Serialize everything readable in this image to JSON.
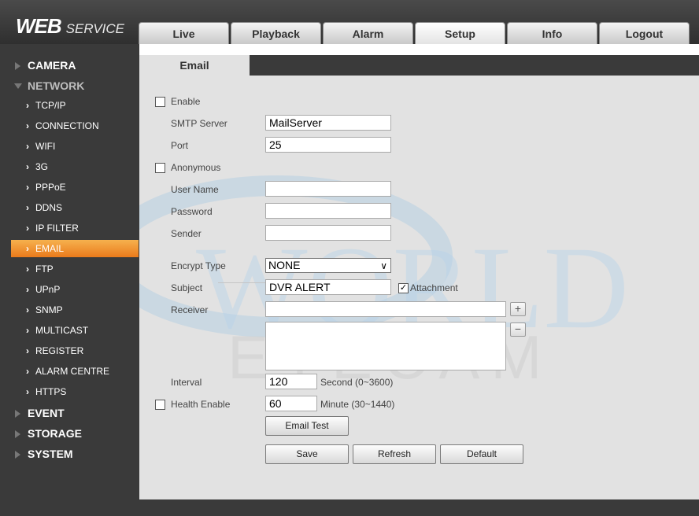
{
  "header": {
    "logo_main": "WEB",
    "logo_sub": "SERVICE"
  },
  "tabs": [
    {
      "label": "Live"
    },
    {
      "label": "Playback"
    },
    {
      "label": "Alarm"
    },
    {
      "label": "Setup",
      "active": true
    },
    {
      "label": "Info"
    },
    {
      "label": "Logout"
    }
  ],
  "sidebar": {
    "groups": [
      {
        "label": "CAMERA"
      },
      {
        "label": "NETWORK"
      },
      {
        "label": "EVENT"
      },
      {
        "label": "STORAGE"
      },
      {
        "label": "SYSTEM"
      }
    ],
    "network_items": [
      {
        "label": "TCP/IP"
      },
      {
        "label": "CONNECTION"
      },
      {
        "label": "WIFI"
      },
      {
        "label": "3G"
      },
      {
        "label": "PPPoE"
      },
      {
        "label": "DDNS"
      },
      {
        "label": "IP FILTER"
      },
      {
        "label": "EMAIL",
        "active": true
      },
      {
        "label": "FTP"
      },
      {
        "label": "UPnP"
      },
      {
        "label": "SNMP"
      },
      {
        "label": "MULTICAST"
      },
      {
        "label": "REGISTER"
      },
      {
        "label": "ALARM CENTRE"
      },
      {
        "label": "HTTPS"
      }
    ]
  },
  "email": {
    "tab_label": "Email",
    "enable_label": "Enable",
    "smtp_label": "SMTP Server",
    "smtp_value": "MailServer",
    "port_label": "Port",
    "port_value": "25",
    "anonymous_label": "Anonymous",
    "username_label": "User Name",
    "username_value": "",
    "password_label": "Password",
    "password_value": "",
    "sender_label": "Sender",
    "sender_value": "",
    "encrypt_label": "Encrypt Type",
    "encrypt_value": "NONE",
    "subject_label": "Subject",
    "subject_value": "DVR ALERT",
    "attachment_label": "Attachment",
    "attachment_checked": true,
    "receiver_label": "Receiver",
    "receiver_value": "",
    "add_symbol": "+",
    "remove_symbol": "−",
    "interval_label": "Interval",
    "interval_value": "120",
    "interval_unit": "Second (0~3600)",
    "health_label": "Health Enable",
    "health_value": "60",
    "health_unit": "Minute (30~1440)",
    "email_test_label": "Email Test",
    "save_label": "Save",
    "refresh_label": "Refresh",
    "default_label": "Default"
  },
  "watermark": {
    "line1": "WORLD",
    "line2": "EYECAM"
  },
  "colors": {
    "active_nav": "#ea7a1b",
    "background": "#3a3a3a",
    "form_bg": "#e2e2e2"
  }
}
